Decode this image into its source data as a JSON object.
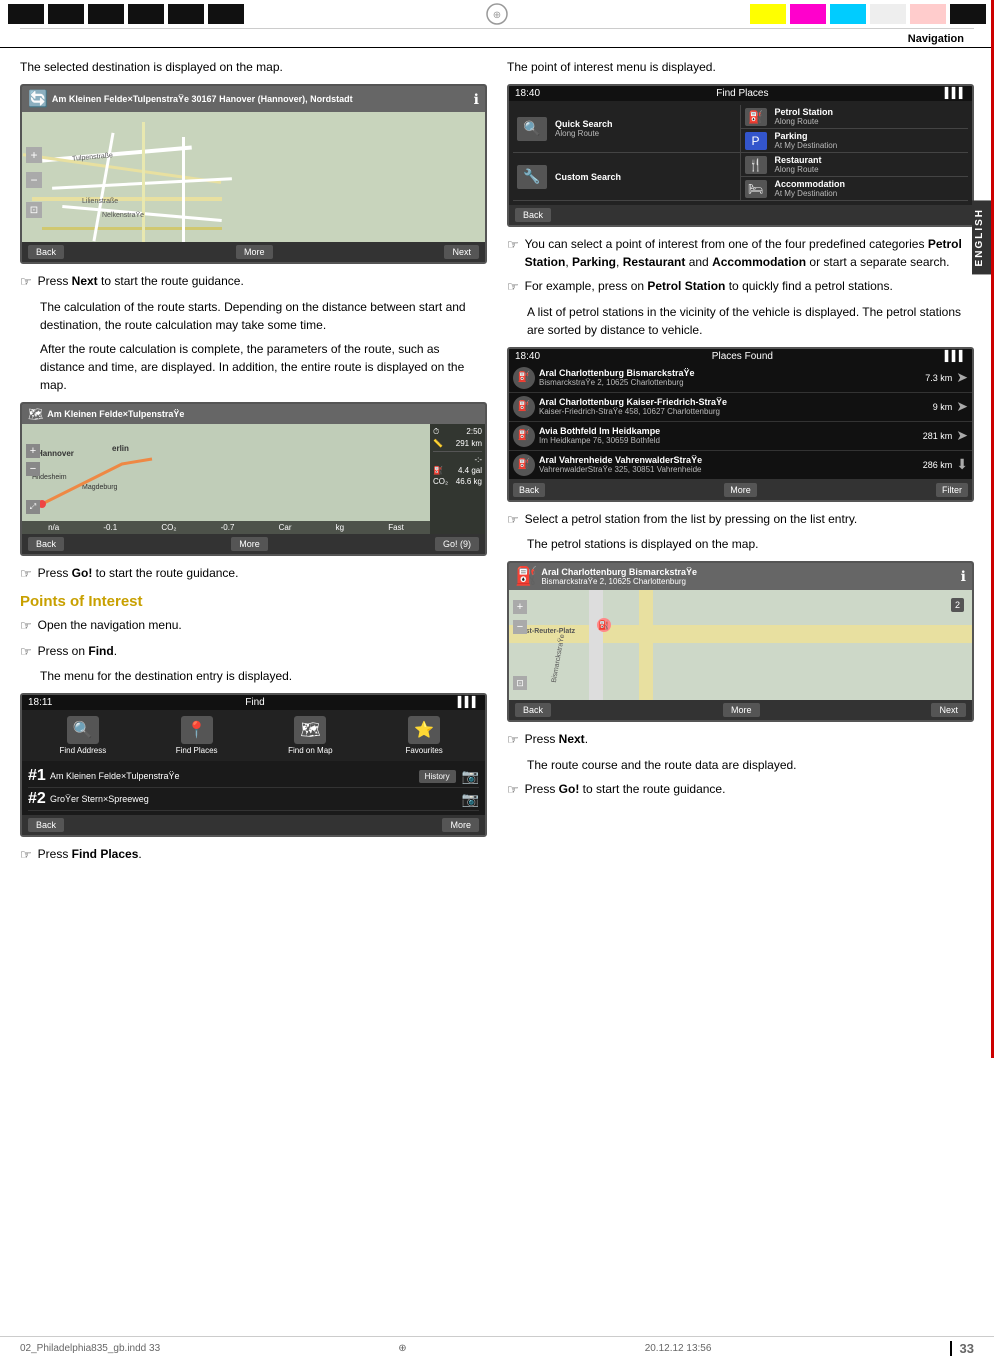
{
  "colors": {
    "top_left_blocks": [
      "#000",
      "#000",
      "#000",
      "#000",
      "#000",
      "#000"
    ],
    "top_right_blocks": [
      "#ffff00",
      "#ff00ff",
      "#00ffff",
      "#fff",
      "#ffcccc",
      "#000"
    ],
    "section_heading_color": "#c8a000",
    "english_bg": "#333"
  },
  "header": {
    "nav_title": "Navigation"
  },
  "left_col": {
    "intro_text": "The selected destination is displayed on the map.",
    "screen1": {
      "address": "Am Kleinen Felde×TulpenstraŸe 30167 Hanover (Hannover), Nordstadt",
      "nav_bar": [
        "Back",
        "More",
        "Next"
      ]
    },
    "bullet1": {
      "arrow": "☞",
      "text_before": "Press ",
      "bold": "Next",
      "text_after": " to start the route guidance."
    },
    "para1": "The calculation of the route starts. Depending on the distance between start and destination, the route calculation may take some time.",
    "para2": "After the route calculation is complete, the parameters of the route, such as distance and time, are displayed. In addition, the entire route is displayed on the map.",
    "screen2": {
      "address": "Am Kleinen Felde×TulpenstraŸe",
      "time": "2:50",
      "dist": "291 km",
      "fuel": "4.4 gal",
      "co2": "46.6 kg",
      "nav_bar": [
        "Back",
        "More",
        "Go! (9)"
      ],
      "cities": [
        "Hannover",
        "Hildesheim",
        "Magdeburg",
        "erlin"
      ],
      "bottom_stats": [
        "n/a",
        "-0.1",
        "-0.7"
      ]
    },
    "bullet2": {
      "arrow": "☞",
      "text_before": "Press ",
      "bold": "Go!",
      "text_after": " to start the route guidance."
    },
    "section_heading": "Points of Interest",
    "bullet3": {
      "arrow": "☞",
      "text": "Open the navigation menu."
    },
    "bullet4": {
      "arrow": "☞",
      "text_before": "Press on ",
      "bold": "Find",
      "text_after": "."
    },
    "para3": "The menu for the destination entry is displayed.",
    "find_screen": {
      "time": "18:11",
      "title": "Find",
      "items": [
        {
          "label": "Find Address",
          "icon": "🔍"
        },
        {
          "label": "Find Places",
          "icon": "📍"
        },
        {
          "label": "Find on Map",
          "icon": "🗺"
        },
        {
          "label": "Favourites",
          "icon": "⭐"
        }
      ],
      "history": [
        {
          "num": "1",
          "addr": "Am Kleinen Felde×TulpenstraŸe",
          "btn": "History"
        },
        {
          "num": "2",
          "addr": "GroŸer Stern×Spreeweg",
          "btn": ""
        }
      ],
      "nav_bar": [
        "Back",
        "More"
      ]
    },
    "bullet5": {
      "arrow": "☞",
      "text_before": "Press ",
      "bold": "Find Places",
      "text_after": "."
    }
  },
  "right_col": {
    "intro_text": "The point of interest menu is displayed.",
    "poi_screen": {
      "time": "18:40",
      "title": "Find Places",
      "items": [
        {
          "icon": "⛽",
          "name": "Petrol Station",
          "sub": "Along Route"
        },
        {
          "icon": "🅿",
          "name": "Parking",
          "sub": "At My Destination"
        },
        {
          "icon": "🍴",
          "name": "Restaurant",
          "sub": "Along Route"
        },
        {
          "icon": "🛏",
          "name": "Accommodation",
          "sub": "At My Destination"
        }
      ],
      "left_labels": [
        "Quick Search Along Route",
        "Custom Search"
      ],
      "nav_bar": [
        "Back"
      ]
    },
    "bullet1": {
      "arrow": "☞",
      "text": "You can select a point of interest from one of the four predefined categories ",
      "bold_items": [
        "Petrol Station",
        "Parking",
        "Restaurant",
        "Accommodation"
      ],
      "text2": " or start a separate search."
    },
    "bullet2": {
      "arrow": "☞",
      "text_before": "For example, press on ",
      "bold": "Petrol Station",
      "text_after": " to quickly find a petrol stations."
    },
    "para1": "A list of petrol stations in the vicinity of the vehicle is displayed. The petrol stations are sorted by distance to vehicle.",
    "places_screen": {
      "time": "18:40",
      "title": "Places Found",
      "places": [
        {
          "name": "Aral Charlottenburg BismarckstraŸe",
          "addr": "BismarckstraŸe 2, 10625 Charlottenburg",
          "dist": "7.3 km"
        },
        {
          "name": "Aral Charlottenburg Kaiser-Friedrich-StraŸe",
          "addr": "Kaiser-Friedrich-StraŸe 458, 10627 Charlottenburg",
          "dist": "9 km"
        },
        {
          "name": "Avia Bothfeld Im Heidkampe",
          "addr": "Im Heidkampe 76, 30659 Bothfeld",
          "dist": "281 km"
        },
        {
          "name": "Aral Vahrenheide VahrenwalderStraŸe",
          "addr": "VahrenwalderStraŸe 325, 30851 Vahrenheide",
          "dist": "286 km"
        }
      ],
      "nav_bar": [
        "Back",
        "More",
        "Filter"
      ]
    },
    "bullet3": {
      "arrow": "☞",
      "text": "Select a petrol station from the list by pressing on the list entry."
    },
    "para2": "The petrol stations is displayed on the map.",
    "petrol_screen": {
      "address": "Aral Charlottenburg BismarckstraŸe BismarckstraŸe 2, 10625 Charlottenburg",
      "nav_bar": [
        "Back",
        "More",
        "Next"
      ],
      "map_labels": [
        "Ernst-Reuter-Platz",
        "BismarckstraŸe"
      ]
    },
    "bullet4": {
      "arrow": "☞",
      "text_before": "Press ",
      "bold": "Next",
      "text_after": "."
    },
    "para3": "The route course and the route data are displayed.",
    "bullet5": {
      "arrow": "☞",
      "text_before": "Press ",
      "bold": "Go!",
      "text_after": " to start the route guidance."
    }
  },
  "footer": {
    "left_text": "02_Philadelphia835_gb.indd   33",
    "copyright_symbol": "⊕",
    "right_text": "20.12.12   13:56",
    "page_number": "33"
  }
}
